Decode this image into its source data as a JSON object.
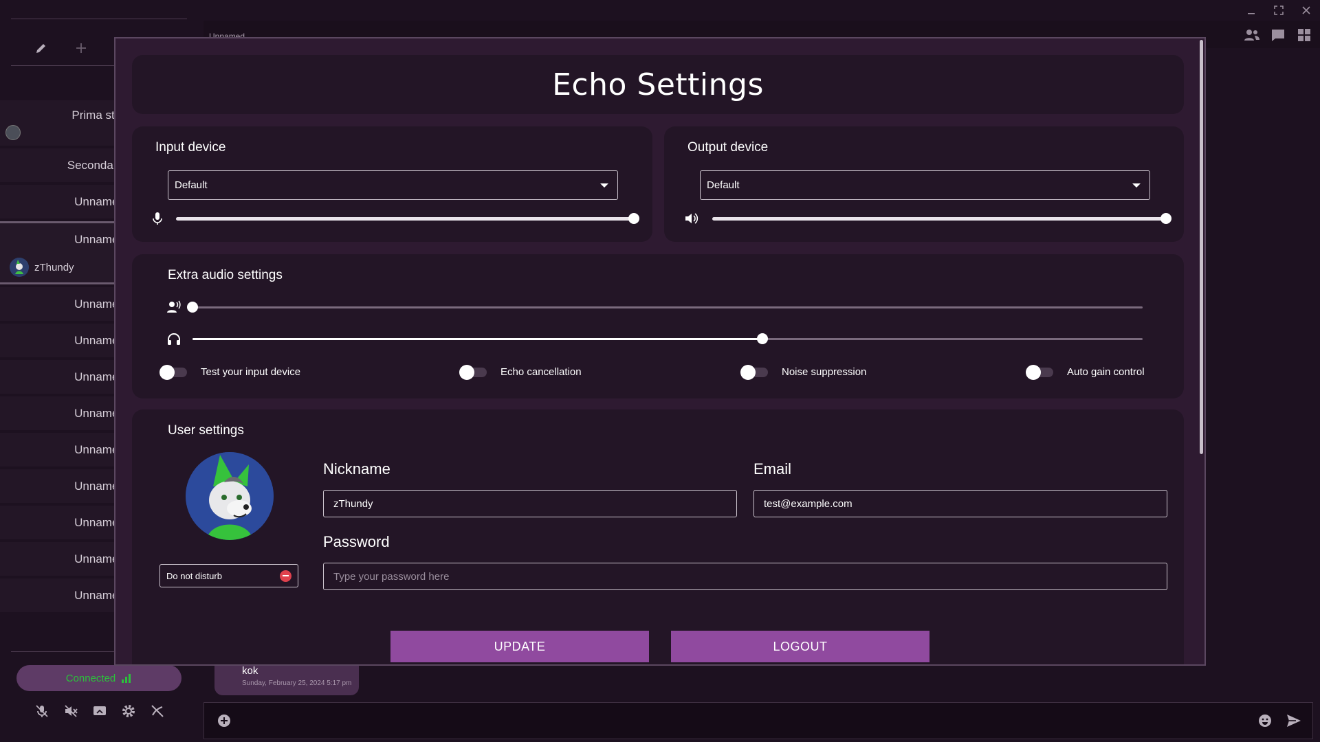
{
  "sidebar": {
    "rooms": [
      {
        "label": "Prima stan"
      },
      {
        "label": "Seconda sta"
      },
      {
        "label": "Unnamed"
      },
      {
        "label": "Unnamed",
        "user": "zThundy"
      },
      {
        "label": "Unnamed"
      },
      {
        "label": "Unnamed"
      },
      {
        "label": "Unnamed"
      },
      {
        "label": "Unnamed"
      },
      {
        "label": "Unnamed"
      },
      {
        "label": "Unnamed"
      },
      {
        "label": "Unnamed"
      },
      {
        "label": "Unnamed"
      },
      {
        "label": "Unnamed"
      }
    ],
    "connection_status": "Connected",
    "connection_color": "#2bc13b"
  },
  "main": {
    "room_title": "Unnamed",
    "message": {
      "text": "kok",
      "date": "Sunday, February 25, 2024 5:17 pm"
    }
  },
  "modal": {
    "title": "Echo Settings",
    "input_device": {
      "label": "Input device",
      "selected": "Default",
      "volume": 1.0
    },
    "output_device": {
      "label": "Output device",
      "selected": "Default",
      "volume": 1.0
    },
    "extra_audio": {
      "label": "Extra audio settings",
      "input_sensitivity": 0.0,
      "monitor_volume": 0.6,
      "toggles": [
        {
          "label": "Test your input device",
          "on": false
        },
        {
          "label": "Echo cancellation",
          "on": false
        },
        {
          "label": "Noise suppression",
          "on": false
        },
        {
          "label": "Auto gain control",
          "on": false
        }
      ]
    },
    "user_settings": {
      "label": "User settings",
      "status": "Do not disturb",
      "nickname_label": "Nickname",
      "nickname": "zThundy",
      "email_label": "Email",
      "email": "test@example.com",
      "password_label": "Password",
      "password_placeholder": "Type your password here",
      "update_label": "UPDATE",
      "logout_label": "LOGOUT"
    }
  },
  "colors": {
    "accent": "#904a9f",
    "background": "#1d1120",
    "modal_bg": "#2e1a31",
    "card_bg": "#231526",
    "dnd": "#e0414d"
  },
  "icons": [
    "minimize-icon",
    "maximize-icon",
    "close-icon",
    "pencil-icon",
    "plus-icon",
    "microphone-icon",
    "speaker-icon",
    "voice-activity-icon",
    "headphones-icon",
    "users-icon",
    "chat-icon",
    "grid-icon",
    "add-circle-icon",
    "emoji-icon",
    "send-icon",
    "signal-icon"
  ]
}
